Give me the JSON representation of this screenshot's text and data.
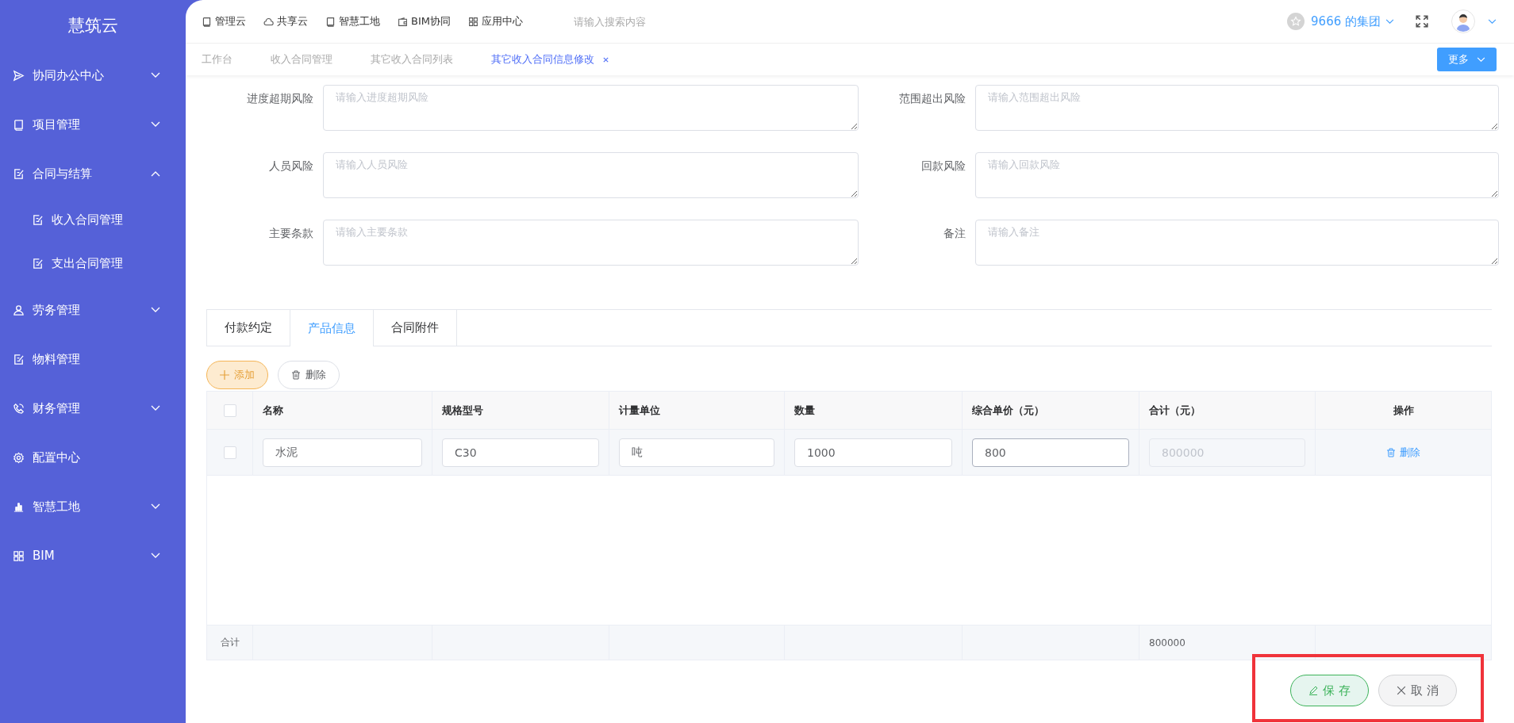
{
  "sidebar": {
    "logo": "慧筑云",
    "items": [
      {
        "label": "协同办公中心",
        "expanded": false
      },
      {
        "label": "项目管理",
        "expanded": false
      },
      {
        "label": "合同与结算",
        "expanded": true,
        "children": [
          {
            "label": "收入合同管理"
          },
          {
            "label": "支出合同管理"
          }
        ]
      },
      {
        "label": "劳务管理",
        "expanded": false
      },
      {
        "label": "物料管理"
      },
      {
        "label": "财务管理",
        "expanded": false
      },
      {
        "label": "配置中心"
      },
      {
        "label": "智慧工地",
        "expanded": false
      },
      {
        "label": "BIM",
        "expanded": false
      }
    ]
  },
  "top_nav": {
    "links": [
      {
        "label": "管理云"
      },
      {
        "label": "共享云"
      },
      {
        "label": "智慧工地"
      },
      {
        "label": "BIM协同"
      },
      {
        "label": "应用中心"
      }
    ],
    "search": {
      "placeholder": "请输入搜索内容"
    },
    "org": "9666 的集团"
  },
  "page_tabs": {
    "tabs": [
      {
        "label": "工作台",
        "selected": false,
        "closable": false
      },
      {
        "label": "收入合同管理",
        "selected": false,
        "closable": false
      },
      {
        "label": "其它收入合同列表",
        "selected": false,
        "closable": false
      },
      {
        "label": "其它收入合同信息修改",
        "selected": true,
        "closable": true
      }
    ],
    "more": "更多"
  },
  "form": {
    "fields": [
      {
        "label": "进度超期风险",
        "placeholder": "请输入进度超期风险"
      },
      {
        "label": "范围超出风险",
        "placeholder": "请输入范围超出风险"
      },
      {
        "label": "人员风险",
        "placeholder": "请输入人员风险"
      },
      {
        "label": "回款风险",
        "placeholder": "请输入回款风险"
      },
      {
        "label": "主要条款",
        "placeholder": "请输入主要条款"
      },
      {
        "label": "备注",
        "placeholder": "请输入备注"
      }
    ]
  },
  "detail_tabs": [
    {
      "label": "付款约定",
      "selected": false
    },
    {
      "label": "产品信息",
      "selected": true
    },
    {
      "label": "合同附件",
      "selected": false
    }
  ],
  "toolbar": {
    "add": "添加",
    "delete": "删除"
  },
  "table": {
    "header_checked": false,
    "columns": [
      "名称",
      "规格型号",
      "计量单位",
      "数量",
      "综合单价（元）",
      "合计（元）",
      "操作"
    ],
    "rows": [
      {
        "checked": false,
        "cells": [
          {
            "value": "水泥",
            "disabled": false,
            "focused": false
          },
          {
            "value": "C30",
            "disabled": false,
            "focused": false
          },
          {
            "value": "吨",
            "disabled": false,
            "focused": false
          },
          {
            "value": "1000",
            "disabled": false,
            "focused": false
          },
          {
            "value": "800",
            "disabled": false,
            "focused": true
          },
          {
            "value": "800000",
            "disabled": true,
            "focused": false
          }
        ],
        "action": "删除"
      }
    ],
    "summary": {
      "label": "合计",
      "total": "800000"
    }
  },
  "footer": {
    "save": "保 存",
    "cancel": "取 消",
    "highlighted": true
  }
}
